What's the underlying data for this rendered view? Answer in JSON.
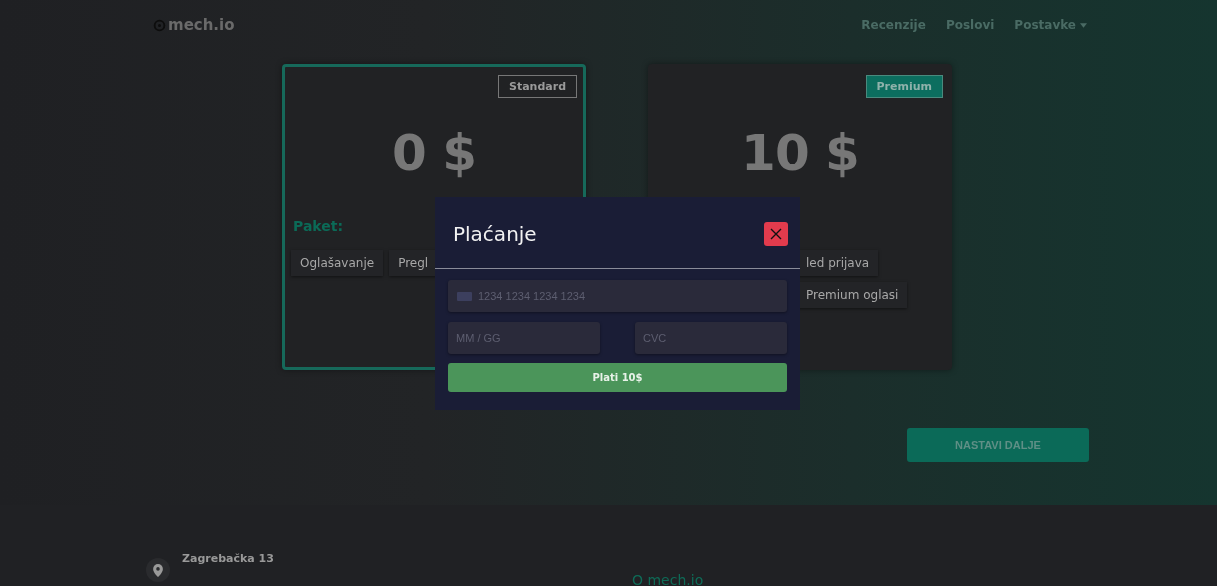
{
  "header": {
    "logo": "mech.io",
    "nav": [
      {
        "label": "Recenzije",
        "kind": "link"
      },
      {
        "label": "Poslovi",
        "kind": "link"
      },
      {
        "label": "Postavke",
        "kind": "dropdown"
      }
    ]
  },
  "plans": [
    {
      "badge": {
        "label": "Standard",
        "kind": "outline"
      },
      "price": "0 $",
      "selected": true,
      "features_label": "Paket:",
      "features": [
        "Oglašavanje",
        "Pregl"
      ]
    },
    {
      "badge": {
        "label": "Premium",
        "kind": "filled"
      },
      "price": "10 $",
      "selected": false,
      "features": [
        "led prijava",
        "Premium oglasi"
      ]
    }
  ],
  "continue_button": "NASTAVI DALJE",
  "modal": {
    "title": "Plaćanje",
    "card_placeholder": "1234 1234 1234 1234",
    "expiry_placeholder": "MM / GG",
    "cvc_placeholder": "CVC",
    "pay_button": "Plati 10$"
  },
  "footer": {
    "address": "Zagrebačka 13",
    "about_title": "O mech.io"
  }
}
